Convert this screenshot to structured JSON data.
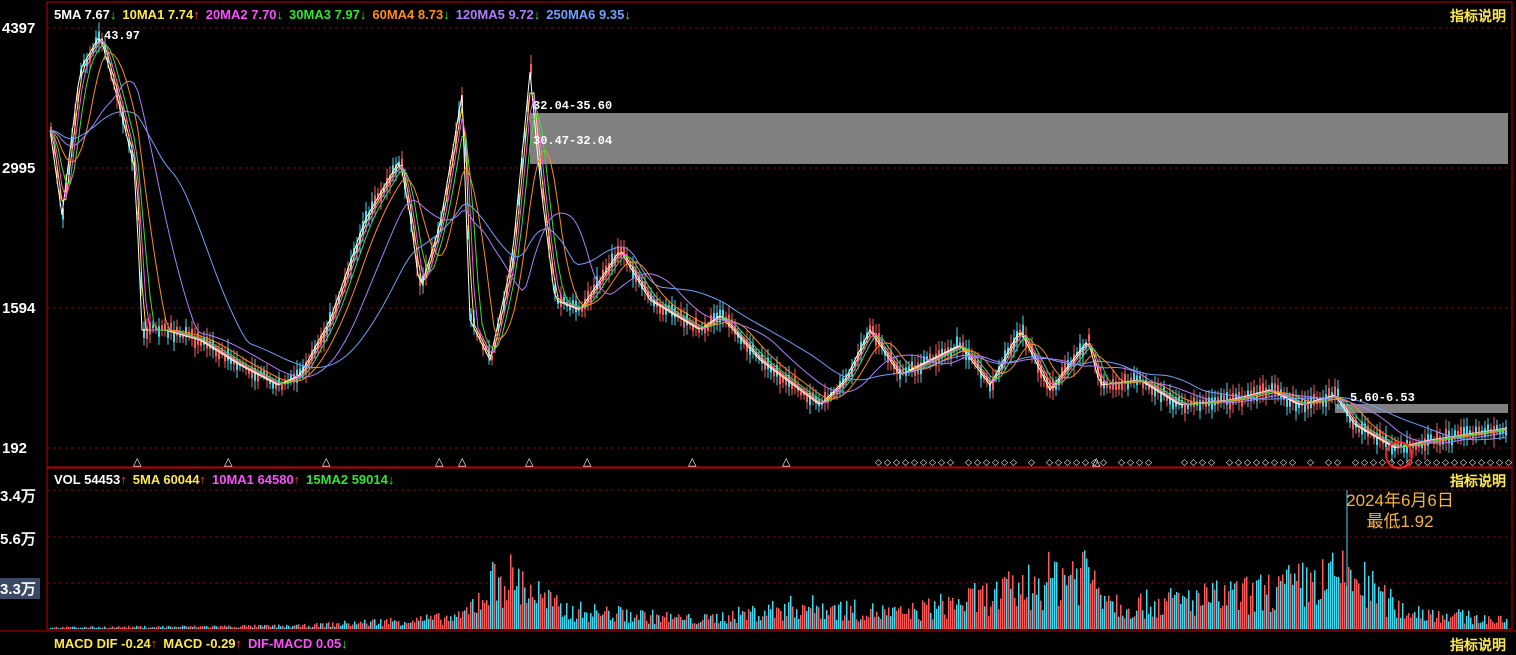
{
  "price_panel": {
    "legend": [
      {
        "label": "5MA",
        "value": "7.67",
        "arrow": "↓",
        "color": "#ffffff",
        "arrow_color": "#2ee82e"
      },
      {
        "label": "10MA1",
        "value": "7.74",
        "arrow": "↑",
        "color": "#ffe94a",
        "arrow_color": "#ff3b3b"
      },
      {
        "label": "20MA2",
        "value": "7.70",
        "arrow": "↓",
        "color": "#ff4dff",
        "arrow_color": "#2ee82e"
      },
      {
        "label": "30MA3",
        "value": "7.97",
        "arrow": "↓",
        "color": "#2ee82e",
        "arrow_color": "#2ee82e"
      },
      {
        "label": "60MA4",
        "value": "8.73",
        "arrow": "↓",
        "color": "#ff8c1a",
        "arrow_color": "#2ee82e"
      },
      {
        "label": "120MA5",
        "value": "9.72",
        "arrow": "↓",
        "color": "#b07cff",
        "arrow_color": "#2ee82e"
      },
      {
        "label": "250MA6",
        "value": "9.35",
        "arrow": "↓",
        "color": "#6fa0ff",
        "arrow_color": "#2ee82e"
      }
    ],
    "help_label": "指标说明",
    "y_ticks": [
      "4397",
      "2995",
      "1594",
      "192"
    ],
    "high_label": "43.97",
    "zone1_label_a": "32.04-35.60",
    "zone1_label_b": "30.47-32.04",
    "zone2_label": "5.60-6.53",
    "triangle_marker": "△",
    "diamond_marker": "◇"
  },
  "volume_panel": {
    "legend": [
      {
        "label": "VOL",
        "value": "54453",
        "arrow": "↑",
        "color": "#ffffff",
        "arrow_color": "#ff3b3b"
      },
      {
        "label": "5MA",
        "value": "60044",
        "arrow": "↑",
        "color": "#ffe94a",
        "arrow_color": "#ff3b3b"
      },
      {
        "label": "10MA1",
        "value": "64580",
        "arrow": "↑",
        "color": "#ff4dff",
        "arrow_color": "#ff3b3b"
      },
      {
        "label": "15MA2",
        "value": "59014",
        "arrow": "↓",
        "color": "#2ee82e",
        "arrow_color": "#2ee82e"
      }
    ],
    "help_label": "指标说明",
    "y_ticks": [
      "3.4万",
      "5.6万",
      "3.3万"
    ],
    "annotation_line1": "2024年6月6日",
    "annotation_line2": "最低1.92"
  },
  "macd_panel": {
    "legend": [
      {
        "label": "MACD DIF",
        "value": "-0.24",
        "arrow": "↑",
        "color": "#ffe94a",
        "arrow_color": "#ff3b3b"
      },
      {
        "label": "MACD",
        "value": "-0.29",
        "arrow": "↑",
        "color": "#ffe94a",
        "arrow_color": "#ff3b3b"
      },
      {
        "label": "DIF-MACD",
        "value": "0.05",
        "arrow": "↓",
        "color": "#ff4dff",
        "arrow_color": "#2ee82e"
      }
    ],
    "help_label": "指标说明"
  },
  "colors": {
    "grid": "#8b0000",
    "frame": "#c00000",
    "zone": "#808080",
    "up": "#ff5a5a",
    "down": "#3fd9f0"
  }
}
